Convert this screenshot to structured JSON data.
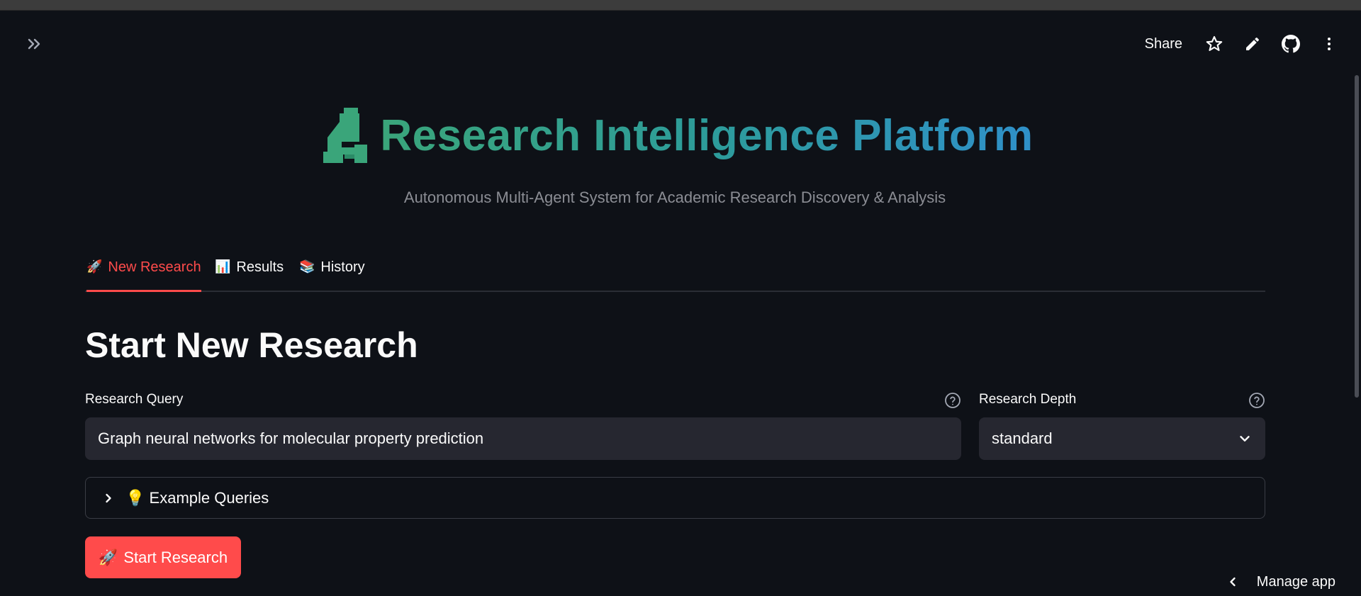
{
  "header": {
    "share_label": "Share",
    "icons": [
      "chevrons-right-icon",
      "star-icon",
      "pencil-icon",
      "github-icon",
      "kebab-menu-icon"
    ]
  },
  "hero": {
    "title": "Research Intelligence Platform",
    "subtitle": "Autonomous Multi-Agent System for Academic Research Discovery & Analysis",
    "icon": "microscope-icon"
  },
  "tabs": [
    {
      "emoji": "🚀",
      "label": "New Research",
      "active": true
    },
    {
      "emoji": "📊",
      "label": "Results",
      "active": false
    },
    {
      "emoji": "📚",
      "label": "History",
      "active": false
    }
  ],
  "main": {
    "heading": "Start New Research",
    "query": {
      "label": "Research Query",
      "value": "Graph neural networks for molecular property prediction"
    },
    "depth": {
      "label": "Research Depth",
      "value": "standard"
    },
    "examples": {
      "emoji": "💡",
      "label": "Example Queries"
    },
    "start_button": {
      "emoji": "🚀",
      "label": "Start Research"
    }
  },
  "footer": {
    "manage_label": "Manage app"
  },
  "colors": {
    "background": "#0e1117",
    "accent": "#ff4b4b",
    "input_bg": "#262730",
    "title_gradient_start": "#3aa57a",
    "title_gradient_end": "#2f90c9"
  }
}
